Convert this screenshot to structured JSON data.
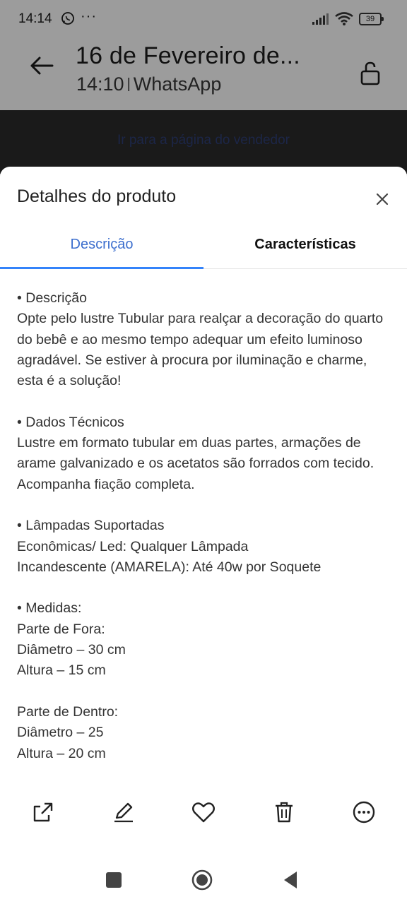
{
  "status": {
    "time": "14:14",
    "extra": "···",
    "battery": "39"
  },
  "header": {
    "title": "16 de Fevereiro de...",
    "time": "14:10",
    "separator": "|",
    "app": "WhatsApp"
  },
  "seller_band": {
    "link": "Ir para a página do vendedor"
  },
  "sheet": {
    "title": "Detalhes do produto",
    "tabs": [
      "Descrição",
      "Características"
    ],
    "active_tab": "Descrição",
    "paragraphs": [
      "• Descrição\nOpte pelo lustre Tubular para realçar a decoração do quarto do bebê e ao mesmo tempo adequar um efeito luminoso agradável. Se estiver à procura por iluminação e charme, esta é a solução!",
      "• Dados Técnicos\nLustre em formato tubular em duas partes, armações de arame galvanizado e os acetatos são forrados com tecido. Acompanha fiação completa.",
      "• Lâmpadas Suportadas\nEconômicas/ Led: Qualquer Lâmpada\nIncandescente (AMARELA): Até 40w por Soquete",
      "• Medidas:\nParte de Fora:\nDiâmetro – 30 cm\nAltura – 15 cm",
      "Parte de Dentro:\nDiâmetro – 25\nAltura – 20 cm"
    ]
  },
  "actions": [
    "share-icon",
    "edit-icon",
    "heart-icon",
    "trash-icon",
    "more-icon"
  ],
  "colors": {
    "accent": "#3483fa",
    "tab_active_text": "#3d6fce",
    "overlay": "#9c9c9c"
  }
}
